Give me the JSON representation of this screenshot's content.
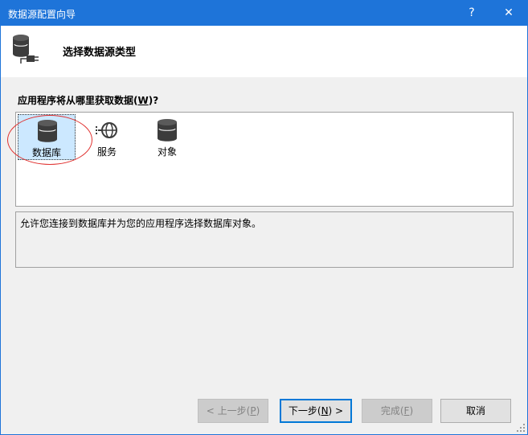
{
  "window": {
    "title": "数据源配置向导",
    "help_glyph": "?",
    "close_glyph": "✕"
  },
  "header": {
    "title": "选择数据源类型"
  },
  "prompt": {
    "label_prefix": "应用程序将从哪里获取数据(",
    "label_mnemonic": "W",
    "label_suffix": ")?"
  },
  "types": [
    {
      "label": "数据库",
      "icon": "database-icon",
      "selected": true
    },
    {
      "label": "服务",
      "icon": "service-globe-icon",
      "selected": false
    },
    {
      "label": "对象",
      "icon": "object-icon",
      "selected": false
    }
  ],
  "description": "允许您连接到数据库并为您的应用程序选择数据库对象。",
  "buttons": {
    "prev": {
      "prefix": "< 上一步(",
      "mnemonic": "P",
      "suffix": ")"
    },
    "next": {
      "prefix": "下一步(",
      "mnemonic": "N",
      "suffix": ") >"
    },
    "finish": {
      "prefix": "完成(",
      "mnemonic": "F",
      "suffix": ")"
    },
    "cancel": {
      "label": "取消"
    }
  },
  "colors": {
    "titlebar": "#1e74d9",
    "selection": "#cce8ff",
    "annotation": "#e0302e"
  }
}
